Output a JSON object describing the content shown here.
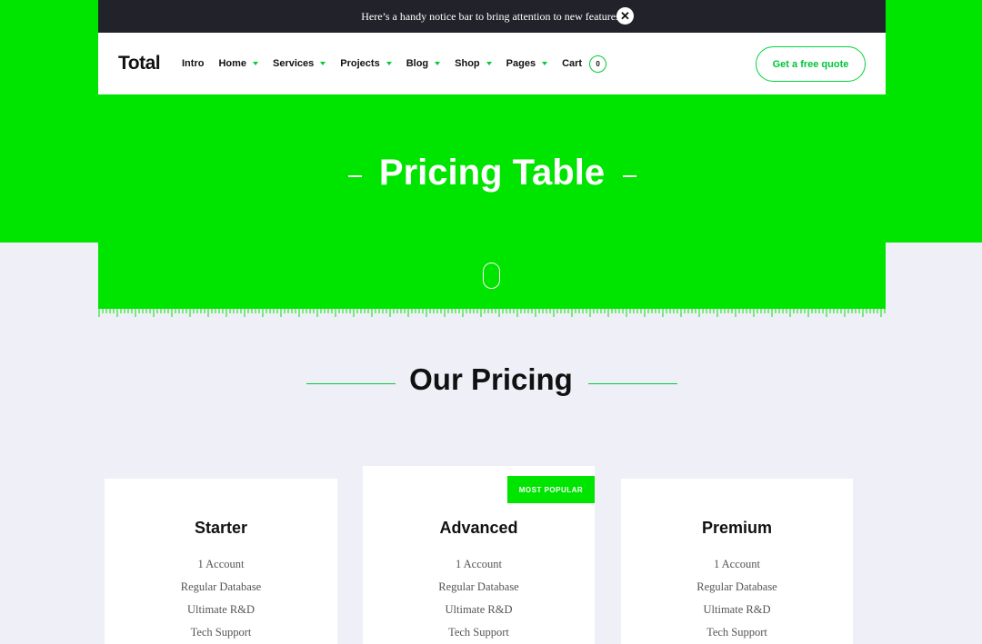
{
  "notice": {
    "text": "Here’s a handy notice bar to bring attention to new features.",
    "close_icon": "close-icon"
  },
  "header": {
    "logo": "Total",
    "nav": [
      {
        "label": "Intro",
        "dropdown": false
      },
      {
        "label": "Home",
        "dropdown": true
      },
      {
        "label": "Services",
        "dropdown": true
      },
      {
        "label": "Projects",
        "dropdown": true
      },
      {
        "label": "Blog",
        "dropdown": true
      },
      {
        "label": "Shop",
        "dropdown": true
      },
      {
        "label": "Pages",
        "dropdown": true
      }
    ],
    "cart": {
      "label": "Cart",
      "count": "0"
    },
    "cta": "Get a free quote"
  },
  "hero": {
    "title": "Pricing Table",
    "scroll_icon": "mouse-icon"
  },
  "section": {
    "title": "Our Pricing"
  },
  "plans": [
    {
      "name": "Starter",
      "badge": "",
      "features": [
        "1 Account",
        "Regular Database",
        "Ultimate R&D",
        "Tech Support"
      ]
    },
    {
      "name": "Advanced",
      "badge": "MOST POPULAR",
      "features": [
        "1 Account",
        "Regular Database",
        "Ultimate R&D",
        "Tech Support"
      ]
    },
    {
      "name": "Premium",
      "badge": "",
      "features": [
        "1 Account",
        "Regular Database",
        "Ultimate R&D",
        "Tech Support"
      ]
    }
  ],
  "colors": {
    "accent": "#00e500",
    "dark": "#22232a",
    "page_bg": "#efeff8"
  }
}
